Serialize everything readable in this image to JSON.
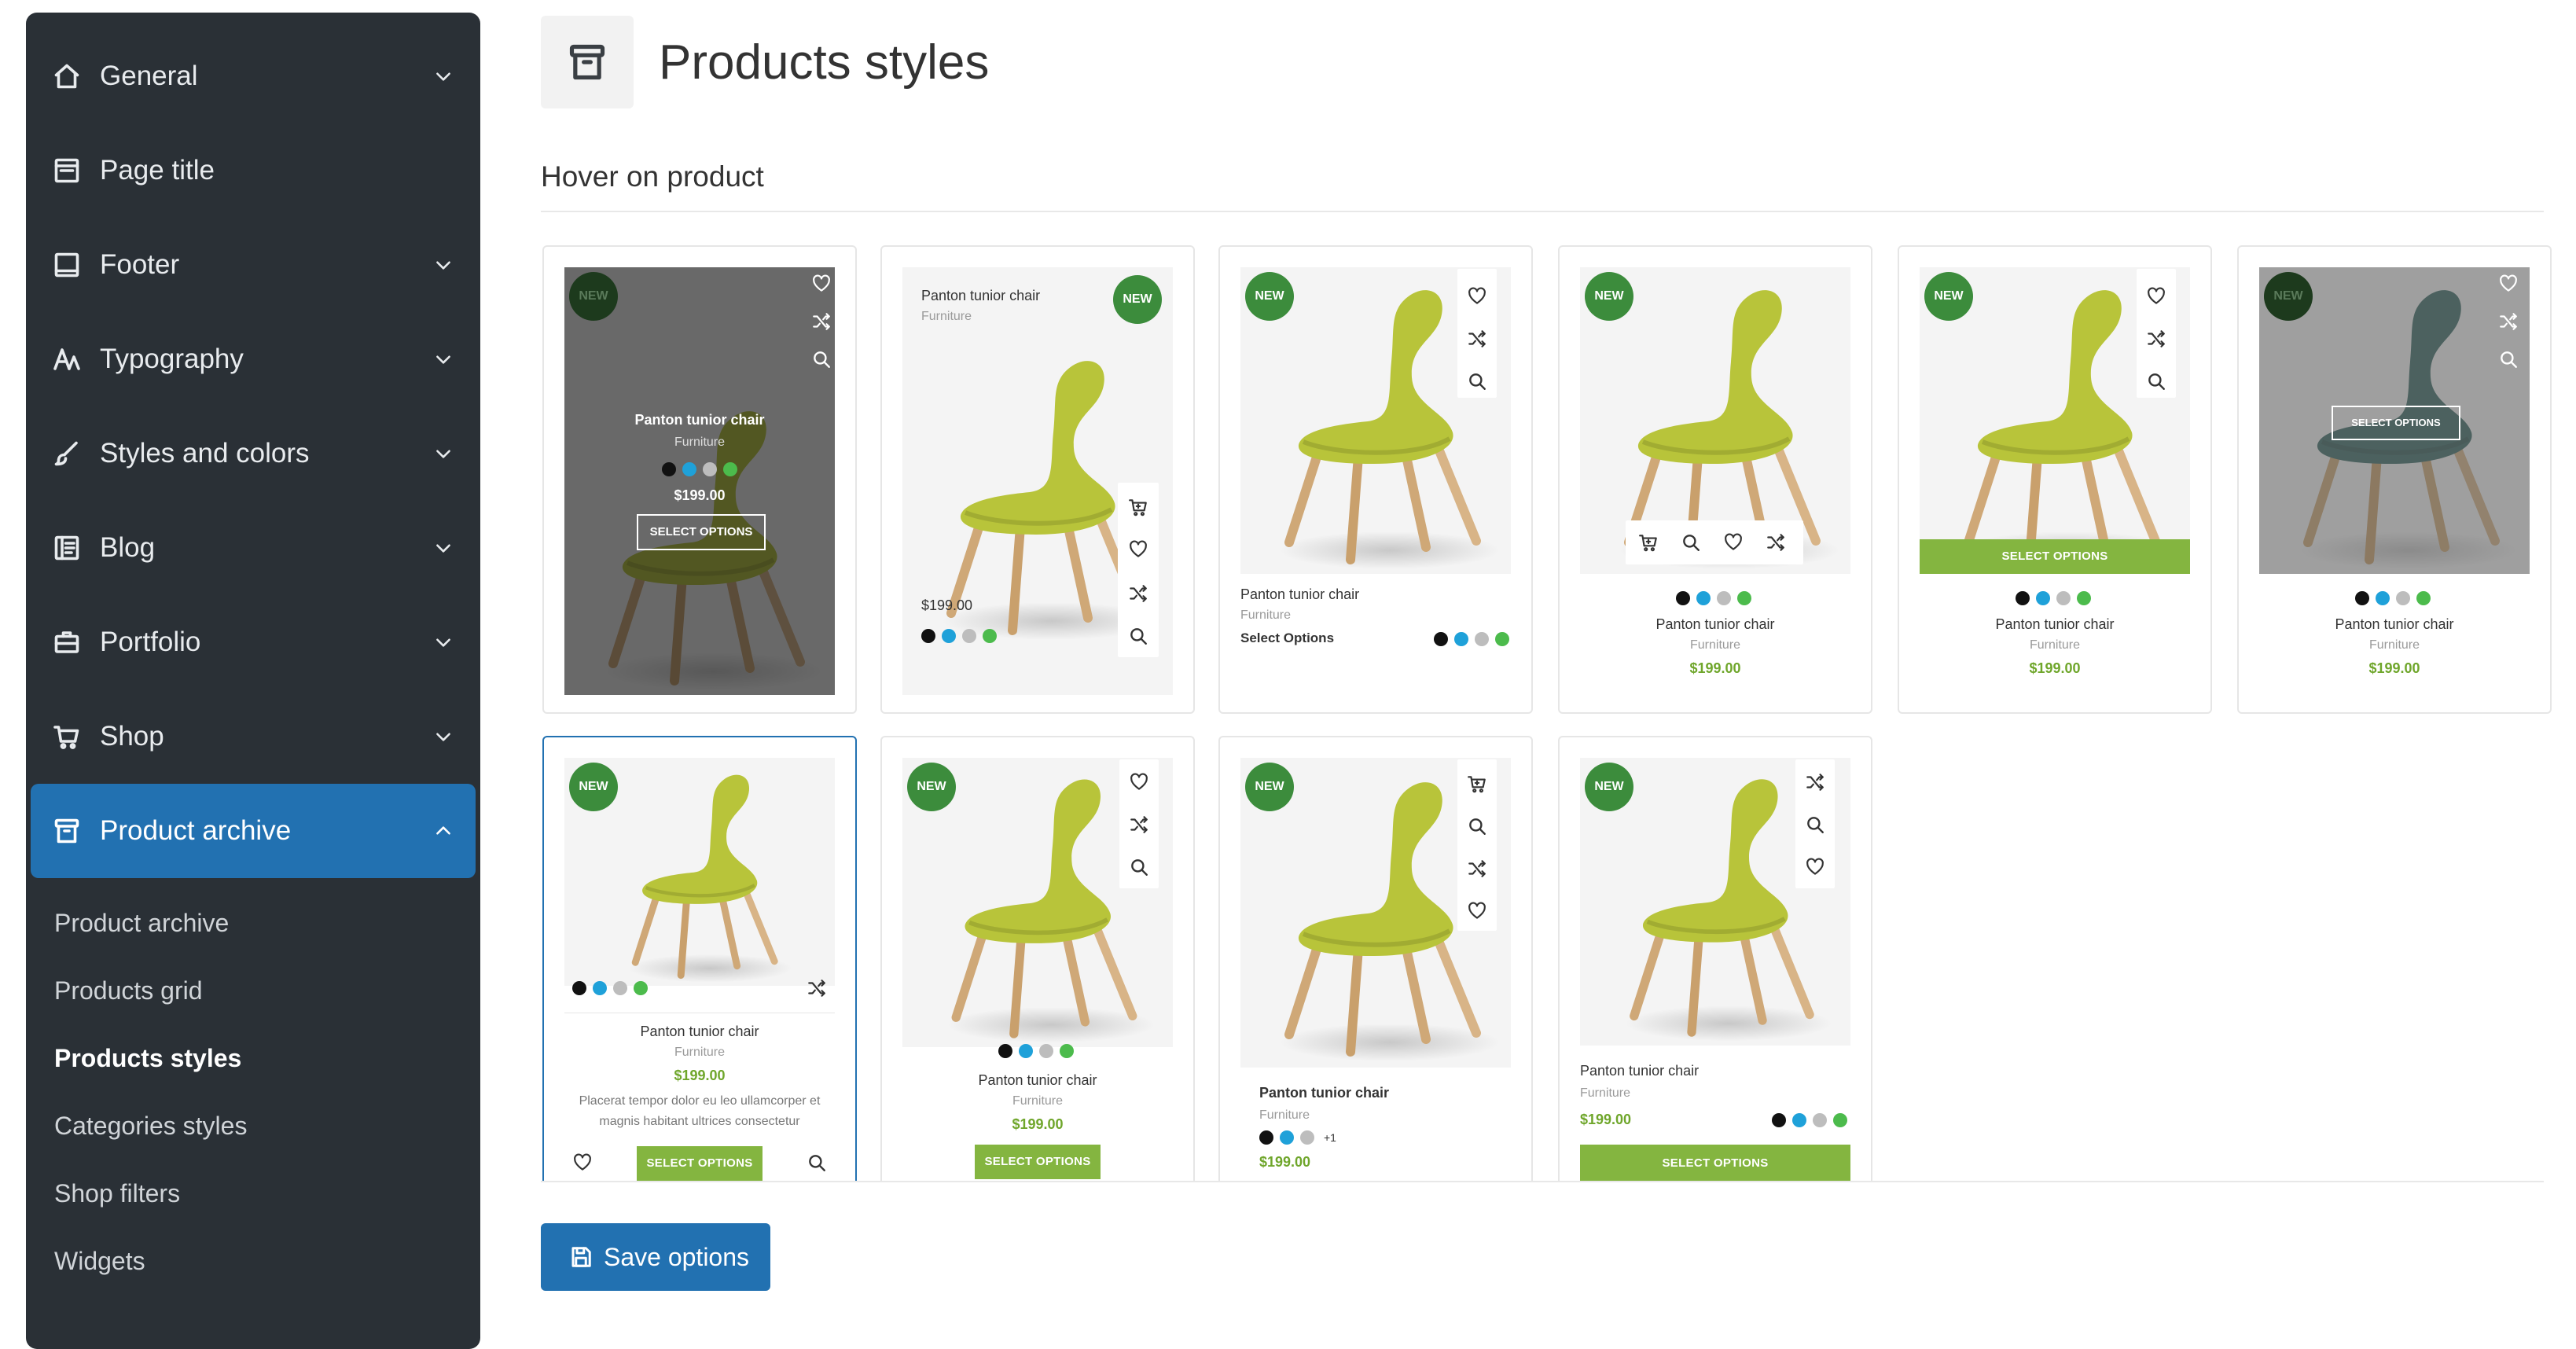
{
  "sidebar": {
    "items": [
      {
        "label": "General",
        "icon": "home-icon",
        "expanded": false
      },
      {
        "label": "Page title",
        "icon": "page-title-icon",
        "expanded": false
      },
      {
        "label": "Footer",
        "icon": "footer-icon",
        "expanded": false
      },
      {
        "label": "Typography",
        "icon": "typography-icon",
        "expanded": false
      },
      {
        "label": "Styles and colors",
        "icon": "brush-icon",
        "expanded": false
      },
      {
        "label": "Blog",
        "icon": "blog-icon",
        "expanded": false
      },
      {
        "label": "Portfolio",
        "icon": "briefcase-icon",
        "expanded": false
      },
      {
        "label": "Shop",
        "icon": "cart-icon",
        "expanded": false
      },
      {
        "label": "Product archive",
        "icon": "archive-icon",
        "expanded": true
      }
    ],
    "subitems": [
      {
        "label": "Product archive",
        "current": false
      },
      {
        "label": "Products grid",
        "current": false
      },
      {
        "label": "Products styles",
        "current": true
      },
      {
        "label": "Categories styles",
        "current": false
      },
      {
        "label": "Shop filters",
        "current": false
      },
      {
        "label": "Widgets",
        "current": false
      }
    ]
  },
  "header": {
    "title": "Products styles",
    "icon": "archive-icon"
  },
  "section": {
    "title": "Hover on product"
  },
  "product": {
    "name": "Panton tunior chair",
    "category": "Furniture",
    "price": "$199.00",
    "badge": "NEW",
    "select_options_upper": "SELECT OPTIONS",
    "select_options_title": "Select Options",
    "more_colors": "+1",
    "description": "Placerat tempor dolor eu leo ullamcorper et magnis habitant ultrices consectetur"
  },
  "swatch_colors": [
    "#111111",
    "#1fa1d9",
    "#bdbdbd",
    "#4cbb4c"
  ],
  "colors": {
    "accent": "#2271b1",
    "sidebar_bg": "#2a3036",
    "button_green": "#84b540",
    "badge_green": "#3c8c3c",
    "price_green": "#6fa62b"
  },
  "footer": {
    "save_label": "Save options"
  }
}
